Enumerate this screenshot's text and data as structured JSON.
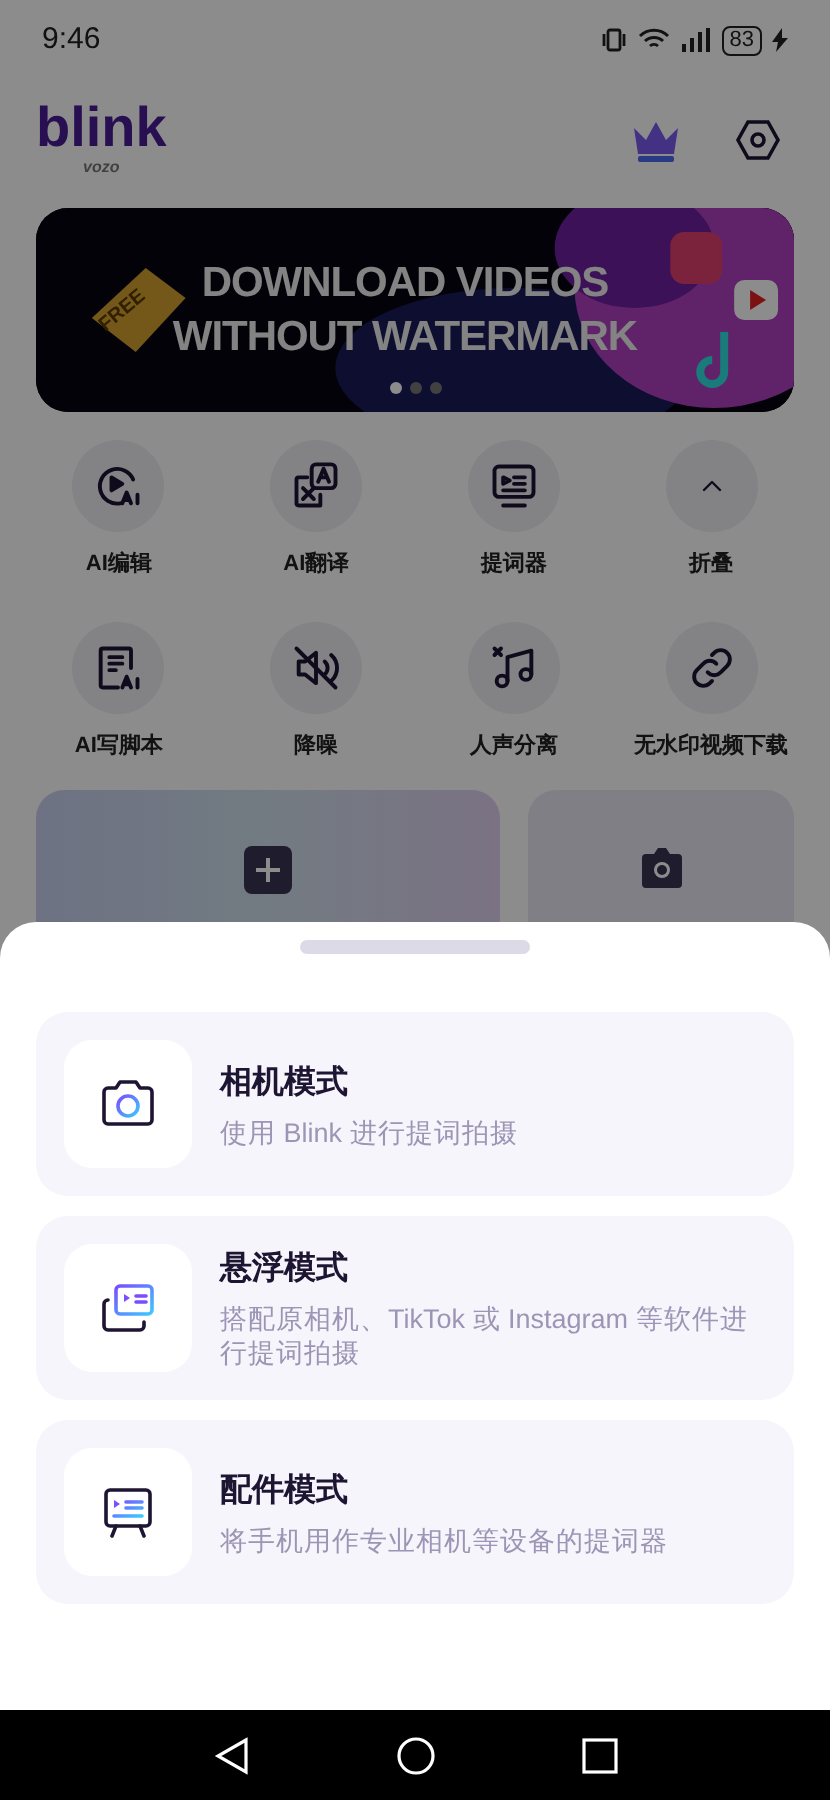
{
  "status_bar": {
    "time": "9:46",
    "battery": "83"
  },
  "header": {
    "logo": "blink",
    "logo_sub": "vozo"
  },
  "banner": {
    "tag": "FREE",
    "headline": [
      "DOWNLOAD VIDEOS",
      "WITHOUT WATERMARK"
    ],
    "dots": [
      {
        "selected": true
      },
      {
        "selected": false
      },
      {
        "selected": false
      }
    ]
  },
  "tools": [
    {
      "kind": "ai-edit",
      "label": "AI编辑"
    },
    {
      "kind": "translate",
      "label": "AI翻译"
    },
    {
      "kind": "prompter",
      "label": "提词器"
    },
    {
      "kind": "collapse",
      "label": "折叠"
    },
    {
      "kind": "script",
      "label": "AI写脚本"
    },
    {
      "kind": "denoise",
      "label": "降噪"
    },
    {
      "kind": "vocal",
      "label": "人声分离"
    },
    {
      "kind": "link",
      "label": "无水印视频下载"
    }
  ],
  "sheet": {
    "options": [
      {
        "kind": "camera",
        "title": "相机模式",
        "description": "使用 Blink 进行提词拍摄"
      },
      {
        "kind": "floating",
        "title": "悬浮模式",
        "description": "搭配原相机、TikTok 或 Instagram 等软件进行提词拍摄"
      },
      {
        "kind": "accessory",
        "title": "配件模式",
        "description": "将手机用作专业相机等设备的提词器"
      }
    ]
  }
}
